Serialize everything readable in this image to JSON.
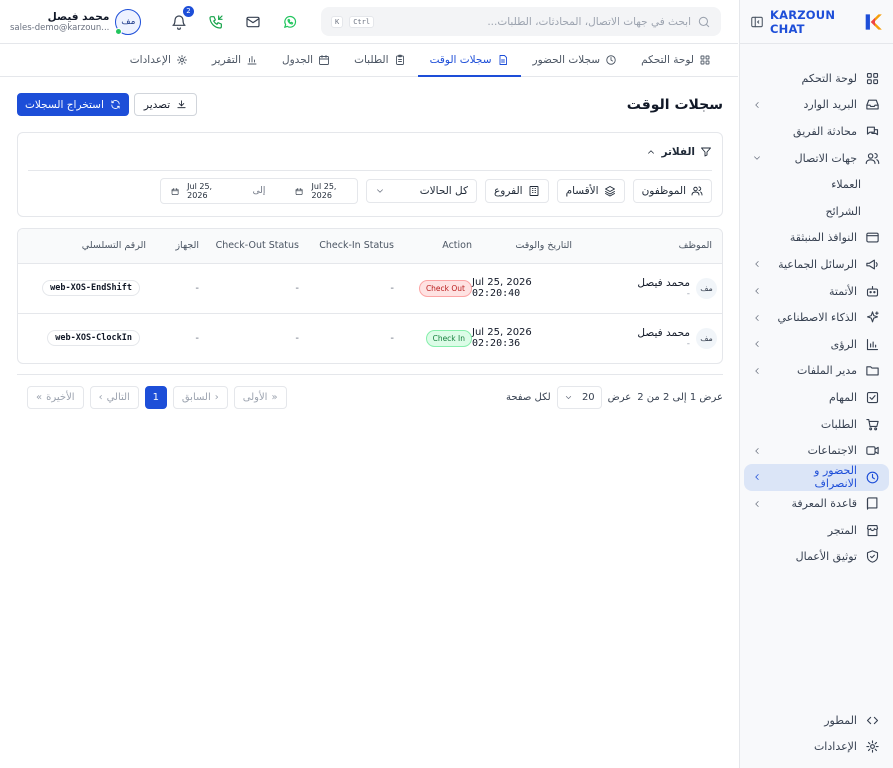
{
  "brand": {
    "name": "KARZOUN CHAT",
    "accent": "#1d4ed8"
  },
  "sidebar": {
    "items": [
      {
        "label": "لوحة التحكم",
        "icon": "grid-icon"
      },
      {
        "label": "البريد الوارد",
        "icon": "inbox-icon",
        "chevron": true
      },
      {
        "label": "محادثة الفريق",
        "icon": "chat-icon"
      },
      {
        "label": "جهات الاتصال",
        "icon": "users-icon",
        "chevron": true,
        "expanded": true
      },
      {
        "label": "العملاء",
        "sub": true
      },
      {
        "label": "الشرائح",
        "sub": true
      },
      {
        "label": "النوافذ المنبثقة",
        "icon": "window-icon"
      },
      {
        "label": "الرسائل الجماعية",
        "icon": "megaphone-icon",
        "chevron": true
      },
      {
        "label": "الأتمتة",
        "icon": "bot-icon",
        "chevron": true
      },
      {
        "label": "الذكاء الاصطناعي",
        "icon": "sparkle-icon",
        "chevron": true
      },
      {
        "label": "الرؤى",
        "icon": "chart-icon",
        "chevron": true
      },
      {
        "label": "مدير الملفات",
        "icon": "folder-icon",
        "chevron": true
      },
      {
        "label": "المهام",
        "icon": "checkbox-icon"
      },
      {
        "label": "الطلبات",
        "icon": "cart-icon"
      },
      {
        "label": "الاجتماعات",
        "icon": "video-icon",
        "chevron": true
      },
      {
        "label": "الحضور و الانصراف",
        "icon": "clock-icon",
        "chevron": true,
        "active": true
      },
      {
        "label": "قاعدة المعرفة",
        "icon": "book-icon",
        "chevron": true
      },
      {
        "label": "المتجر",
        "icon": "store-icon"
      },
      {
        "label": "توثيق الأعمال",
        "icon": "shield-icon"
      }
    ],
    "bottom": [
      {
        "label": "المطور",
        "icon": "code-icon"
      },
      {
        "label": "الإعدادات",
        "icon": "gear-icon"
      }
    ]
  },
  "header": {
    "search_placeholder": "ابحث في جهات الاتصال، المحادثات، الطلبات...",
    "kbd_ctrl": "Ctrl",
    "kbd_k": "K",
    "notifications_count": "2",
    "user_name": "محمد فيصل",
    "user_email": "sales-demo@karzoun...",
    "user_initials": "مف"
  },
  "tabs": [
    {
      "label": "لوحة التحكم",
      "icon": "grid-icon"
    },
    {
      "label": "سجلات الحضور",
      "icon": "clock-icon"
    },
    {
      "label": "سجلات الوقت",
      "icon": "file-icon",
      "active": true
    },
    {
      "label": "الطلبات",
      "icon": "clipboard-icon"
    },
    {
      "label": "الجدول",
      "icon": "calendar-icon"
    },
    {
      "label": "التقرير",
      "icon": "bar-chart-icon"
    },
    {
      "label": "الإعدادات",
      "icon": "gear-icon"
    }
  ],
  "page": {
    "title": "سجلات الوقت",
    "export_label": "تصدير",
    "fetch_label": "استخراج السجلات"
  },
  "filters": {
    "title": "الفلاتر",
    "employees": "الموظفون",
    "departments": "الأقسام",
    "branches": "الفروع",
    "status": "كل الحالات",
    "date_from": "Jul 25, 2026",
    "date_to": "Jul 25, 2026",
    "date_sep": "إلى"
  },
  "table": {
    "headers": [
      "الموظف",
      "التاريخ والوقت",
      "Action",
      "Check-In Status",
      "Check-Out Status",
      "الجهاز",
      "الرقم التسلسلي"
    ],
    "rows": [
      {
        "initials": "مف",
        "name": "محمد فيصل",
        "sub": "-",
        "date": "Jul 25, 2026",
        "time": "02:20:40",
        "action": "Check Out",
        "action_type": "out",
        "check_in_status": "-",
        "check_out_status": "-",
        "device": "-",
        "serial": "web-XOS-EndShift"
      },
      {
        "initials": "مف",
        "name": "محمد فيصل",
        "sub": "-",
        "date": "Jul 25, 2026",
        "time": "02:20:36",
        "action": "Check In",
        "action_type": "in",
        "check_in_status": "-",
        "check_out_status": "-",
        "device": "-",
        "serial": "web-XOS-ClockIn"
      }
    ]
  },
  "pagination": {
    "summary": "عرض 1 إلى 2 من 2",
    "show_label": "عرض",
    "page_size": "20",
    "per_page_label": "لكل صفحة",
    "first": "الأولى",
    "prev": "السابق",
    "current": "1",
    "next": "التالي",
    "last": "الأخيرة"
  }
}
